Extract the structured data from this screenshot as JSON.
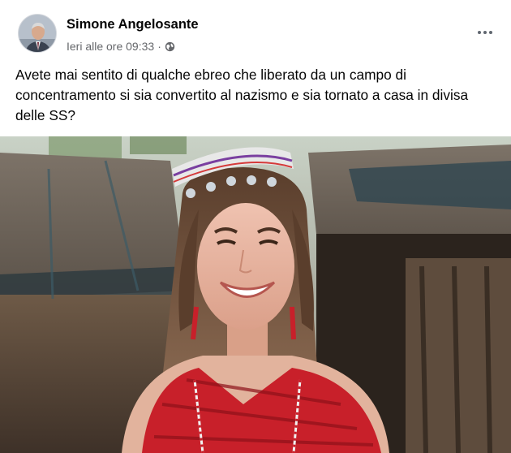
{
  "post": {
    "author": "Simone Angelosante",
    "timestamp": "Ieri alle ore 09:33",
    "separator": "·",
    "audience_icon": "globe-icon",
    "more_icon": "more-horizontal-icon",
    "body_text": "Avete mai sentito di qualche ebreo che liberato da un campo di concentramento si sia convertito al nazismo e sia tornato a casa in divisa delle SS?"
  },
  "colors": {
    "name": "#050505",
    "meta": "#65676b",
    "shirt_red": "#c8202a"
  }
}
